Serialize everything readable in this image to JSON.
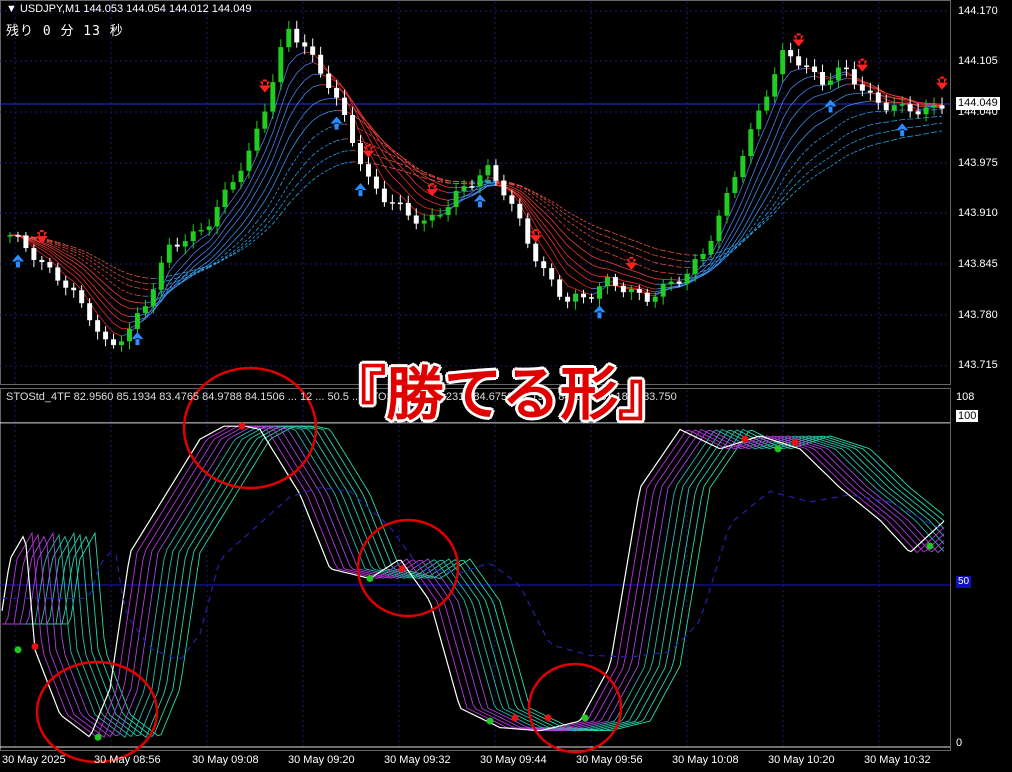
{
  "header": {
    "symbol_line": "USDJPY,M1  144.053 144.054 144.012 144.049",
    "timer": "残り 0 分 13 秒"
  },
  "price_axis": {
    "labels": [
      "144.170",
      "144.105",
      "144.040",
      "143.975",
      "143.910",
      "143.845",
      "143.780",
      "143.715"
    ],
    "current_price": "144.049"
  },
  "indicator": {
    "header": "STOStd_4TF 82.9560 85.1934 83.4765 84.9788 84.1506 ... 12 ... 50.5 ... STOStd ... 82 ... 2316 84.6750 81.1911 84.1011 81.1808 83.750",
    "axis_labels": [
      "108",
      "100",
      "50",
      "0"
    ]
  },
  "time_axis": {
    "labels": [
      "30 May 2025",
      "30 May 08:56",
      "30 May 09:08",
      "30 May 09:20",
      "30 May 09:32",
      "30 May 09:44",
      "30 May 09:56",
      "30 May 10:08",
      "30 May 10:20",
      "30 May 10:32"
    ]
  },
  "overlay": {
    "title": "『勝てる形』"
  },
  "colors": {
    "background": "#000000",
    "grid": "#1a1a6e",
    "bull_candle": "#22cc22",
    "bear_candle": "#ffffff",
    "sell_arrow": "#ff2020",
    "buy_arrow": "#2a8cff",
    "circle": "#e00000",
    "level_line": "#1a1ad0"
  },
  "chart_data": {
    "type": "candlestick",
    "symbol": "USDJPY",
    "timeframe": "M1",
    "ylim": [
      143.7,
      144.18
    ],
    "close_path": [
      143.882,
      143.87,
      143.842,
      143.815,
      143.79,
      143.742,
      143.763,
      143.813,
      143.868,
      143.88,
      143.905,
      143.94,
      143.985,
      144.06,
      144.14,
      144.12,
      144.08,
      144.02,
      143.96,
      143.93,
      143.91,
      143.905,
      143.92,
      143.945,
      143.975,
      143.935,
      143.885,
      143.84,
      143.8,
      143.81,
      143.83,
      143.815,
      143.81,
      143.82,
      143.83,
      143.87,
      143.92,
      143.99,
      144.06,
      144.11,
      144.1,
      144.08,
      144.09,
      144.07,
      144.05,
      144.04,
      144.045,
      144.049
    ],
    "stochastic": {
      "ylim": [
        0,
        108
      ],
      "levels": [
        0,
        50,
        100
      ]
    }
  }
}
